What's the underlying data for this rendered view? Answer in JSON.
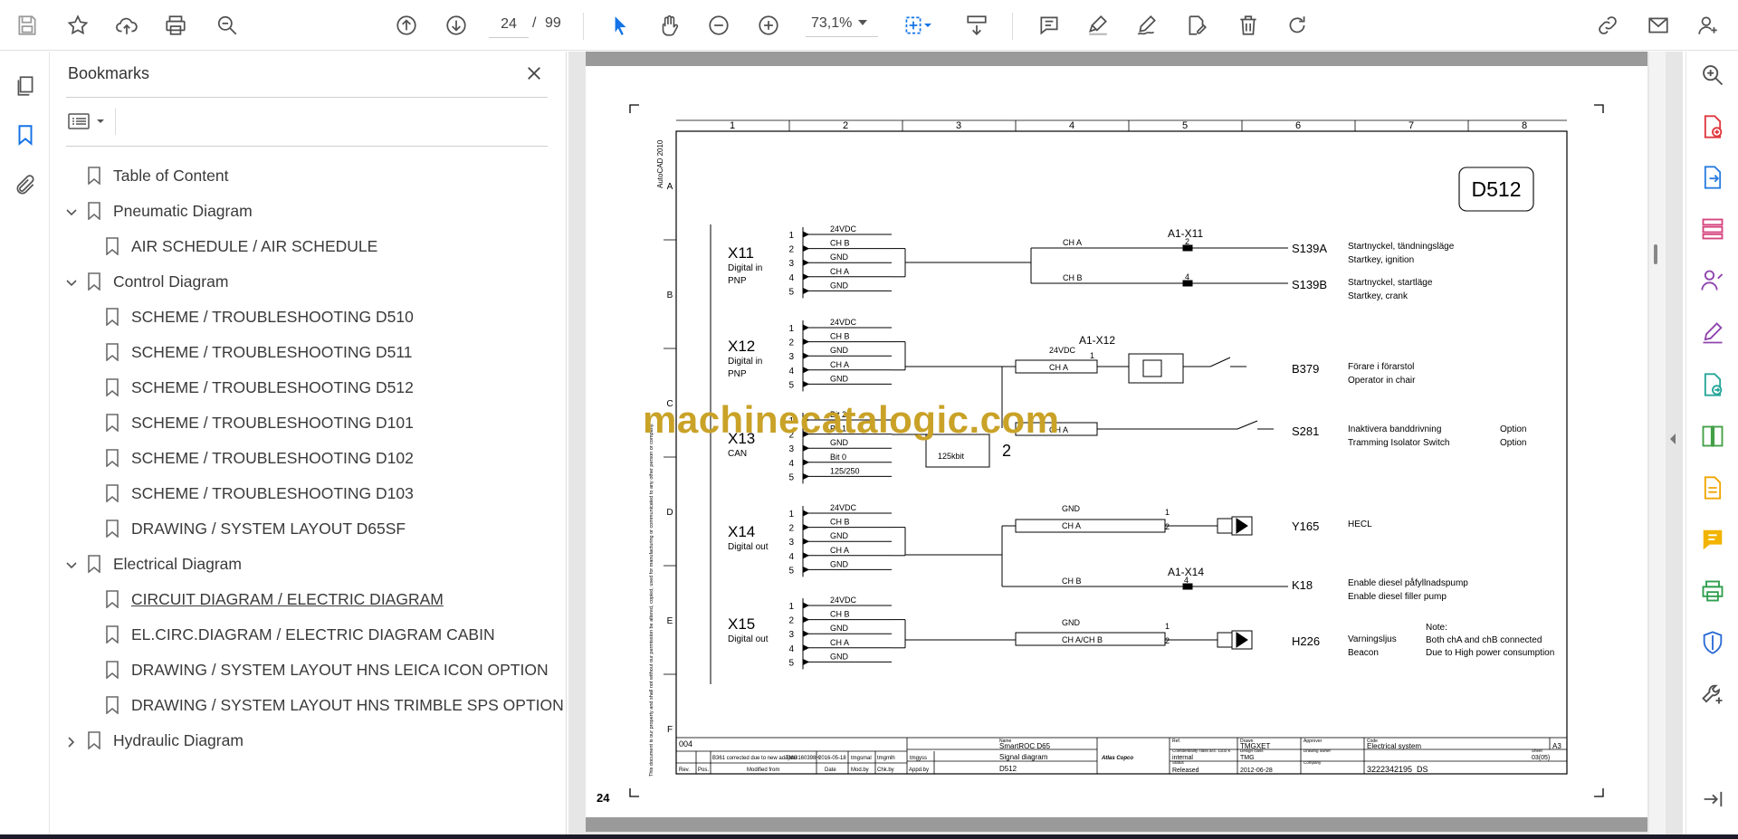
{
  "toolbar": {
    "page_current": "24",
    "page_separator": "/",
    "page_total": "99",
    "zoom": "73,1%",
    "icons": [
      "save-icon",
      "star-icon",
      "upload-icon",
      "print-icon",
      "search-zoom-icon",
      "page-up-icon",
      "page-down-icon",
      "zoom-out-icon",
      "zoom-in-icon",
      "select-arrow-icon",
      "hand-icon",
      "fit-page-icon",
      "scroll-mode-icon",
      "comment-icon",
      "highlight-icon",
      "sign-icon",
      "edit-icon",
      "delete-icon",
      "rotate-icon",
      "link-icon",
      "email-icon",
      "account-icon"
    ]
  },
  "bookmarks_panel": {
    "title": "Bookmarks",
    "items": [
      {
        "label": "Table of Content",
        "level": 0,
        "expandable": false
      },
      {
        "label": "Pneumatic Diagram",
        "level": 0,
        "expandable": true,
        "expanded": true
      },
      {
        "label": "AIR SCHEDULE / AIR SCHEDULE",
        "level": 1
      },
      {
        "label": "Control Diagram",
        "level": 0,
        "expandable": true,
        "expanded": true
      },
      {
        "label": "SCHEME / TROUBLESHOOTING D510",
        "level": 1
      },
      {
        "label": "SCHEME / TROUBLESHOOTING D511",
        "level": 1
      },
      {
        "label": "SCHEME / TROUBLESHOOTING D512",
        "level": 1
      },
      {
        "label": "SCHEME / TROUBLESHOOTING D101",
        "level": 1
      },
      {
        "label": "SCHEME / TROUBLESHOOTING D102",
        "level": 1
      },
      {
        "label": "SCHEME / TROUBLESHOOTING D103",
        "level": 1
      },
      {
        "label": "DRAWING / SYSTEM LAYOUT D65SF",
        "level": 1
      },
      {
        "label": "Electrical Diagram",
        "level": 0,
        "expandable": true,
        "expanded": true
      },
      {
        "label": "CIRCUIT DIAGRAM / ELECTRIC DIAGRAM",
        "level": 1,
        "current": true
      },
      {
        "label": "EL.CIRC.DIAGRAM / ELECTRIC DIAGRAM CABIN",
        "level": 1
      },
      {
        "label": "DRAWING / SYSTEM LAYOUT HNS LEICA ICON OPTION",
        "level": 1
      },
      {
        "label": "DRAWING / SYSTEM LAYOUT HNS TRIMBLE SPS OPTION",
        "level": 1
      },
      {
        "label": "Hydraulic Diagram",
        "level": 0,
        "expandable": true,
        "expanded": false
      }
    ]
  },
  "document": {
    "page_number": "24",
    "watermark": "machinecatalogic.com",
    "drawing_id": "D512",
    "autocad": "AutoCAD 2010",
    "col_numbers": [
      "1",
      "2",
      "3",
      "4",
      "5",
      "6",
      "7",
      "8"
    ],
    "row_letters": [
      "A",
      "B",
      "C",
      "D",
      "E",
      "F"
    ],
    "connectors": [
      {
        "name": "X11",
        "type1": "Digital in",
        "type2": "PNP"
      },
      {
        "name": "X12",
        "type1": "Digital in",
        "type2": "PNP"
      },
      {
        "name": "X13",
        "type1": "CAN",
        "type2": ""
      },
      {
        "name": "X14",
        "type1": "Digital out",
        "type2": ""
      },
      {
        "name": "X15",
        "type1": "Digital out",
        "type2": ""
      }
    ],
    "pins": [
      "1",
      "2",
      "3",
      "4",
      "5"
    ],
    "x11_signals": [
      "24VDC",
      "CH B",
      "GND",
      "CH A",
      "GND"
    ],
    "x12_signals": [
      "24VDC",
      "CH B",
      "GND",
      "CH A",
      "GND"
    ],
    "x13_signals": [
      "Bit 2",
      "Bit 1",
      "GND",
      "Bit 0",
      "125/250"
    ],
    "x14_signals": [
      "24VDC",
      "CH B",
      "GND",
      "CH A",
      "GND"
    ],
    "x15_signals": [
      "24VDC",
      "CH B",
      "GND",
      "CH A",
      "GND"
    ],
    "labels": {
      "a1x11": "A1-X11",
      "a1x12": "A1-X12",
      "a1x14": "A1-X14",
      "cha": "CH A",
      "chb": "CH B",
      "gnd": "GND",
      "v24": "24VDC",
      "chachb": "CH A/CH B",
      "can_rate": "125kbit",
      "can_num": "2",
      "pin1": "1",
      "pin2": "2",
      "pin4": "4"
    },
    "components": [
      {
        "tag": "S139A",
        "desc1": "Startnyckel, tändningsläge",
        "desc2": "Startkey, ignition"
      },
      {
        "tag": "S139B",
        "desc1": "Startnyckel, startläge",
        "desc2": "Startkey, crank"
      },
      {
        "tag": "B379",
        "desc1": "Förare i förarstol",
        "desc2": "Operator in chair"
      },
      {
        "tag": "S281",
        "desc1": "Inaktivera banddrivning",
        "desc2": "Tramming Isolator Switch",
        "opt1": "Option",
        "opt2": "Option"
      },
      {
        "tag": "Y165",
        "desc1": "HECL",
        "desc2": ""
      },
      {
        "tag": "K18",
        "desc1": "Enable diesel påfyllnadspump",
        "desc2": "Enable diesel filler pump"
      },
      {
        "tag": "H226",
        "desc1": "Varningsljus",
        "desc2": "Beacon",
        "note0": "Note:",
        "note1": "Both chA and chB connected",
        "note2": "Due to High power consumption"
      }
    ],
    "titleblock": {
      "rev": "004",
      "change": "B361 corrected due to new adapter",
      "ref": "TMG160398H",
      "date": "2016-05-18",
      "by1": "tmgsmal",
      "by2": "tmgmlh",
      "by3": "tmgyss",
      "rev_h": "Rev.",
      "pos_h": "Pos.",
      "modified_h": "Modified from",
      "date_h": "Date",
      "modby_h": "Mod.by",
      "chkby_h": "Chk.by",
      "appby_h": "Appd.by",
      "name_h": "Name",
      "product": "SmartROC D65",
      "title": "Signal diagram",
      "drawing": "D512",
      "brand": "Atlas Copco",
      "ref_h": "Ref.",
      "conf": "internal",
      "status_h": "Status",
      "status": "Released",
      "drawn_h": "Drawn",
      "drawn": "TMGXET",
      "design_owner_h": "Drawing owner",
      "design_owner": "TMG",
      "date2": "2012-06-28",
      "approver_h": "Approver",
      "company_h": "Company",
      "code_h": "Code",
      "code": "Electrical system",
      "size": "A3",
      "sheet_h": "Sheet",
      "sheet": "03(05)",
      "docno": "3222342195_DS",
      "conf_h": "Confidentiality class acc. 1102 K",
      "design_h": "Design class",
      "side_note": "This document is our property and shall not without our permission be altered, copied, used for manufacturing or communicated to any other person or company."
    }
  }
}
